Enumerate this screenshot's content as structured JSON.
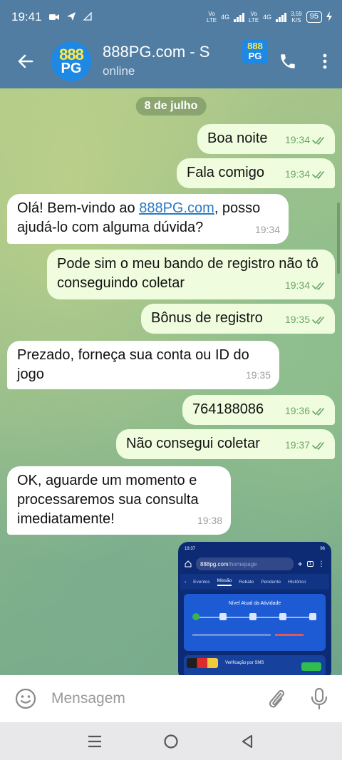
{
  "status_bar": {
    "time": "19:41",
    "net1_top": "Vo",
    "net1_bottom": "LTE",
    "sig1_label": "4G",
    "net2_top": "Vo",
    "net2_bottom": "LTE",
    "sig2_label": "4G",
    "speed_value": "3,59",
    "speed_unit": "K/S",
    "battery": "95"
  },
  "header": {
    "title": "888PG.com - S",
    "status": "online",
    "avatar_top": "888",
    "avatar_bottom": "PG"
  },
  "chat": {
    "date": "8 de julho",
    "messages": [
      {
        "text": "Boa noite",
        "time": "19:34"
      },
      {
        "text": "Fala comigo",
        "time": "19:34"
      },
      {
        "text_before": "Olá! Bem-vindo ao ",
        "link": "888PG.com",
        "text_after": ", posso ajudá-lo com alguma dúvida?",
        "time": "19:34"
      },
      {
        "text": "Pode sim o meu bando de registro não tô conseguindo coletar",
        "time": "19:34"
      },
      {
        "text": "Bônus de registro",
        "time": "19:35"
      },
      {
        "text": "Prezado, forneça sua conta ou ID do jogo",
        "time": "19:35"
      },
      {
        "text": "764188086",
        "time": "19:36"
      },
      {
        "text": "Não consegui coletar",
        "time": "19:37"
      },
      {
        "text": "OK, aguarde um momento e processaremos sua consulta imediatamente!",
        "time": "19:38"
      }
    ]
  },
  "media_preview": {
    "time": "19:37",
    "battery": "96",
    "url": "888pg.com",
    "url_path": "/homepage",
    "tabs": [
      "Eventos",
      "Missão",
      "Rebate",
      "Pendente",
      "Histórico"
    ],
    "active_tab": "Missão",
    "level_title": "Nível Atual da Atividade",
    "task_label": "Verificação por SMS"
  },
  "input": {
    "placeholder": "Mensagem"
  }
}
